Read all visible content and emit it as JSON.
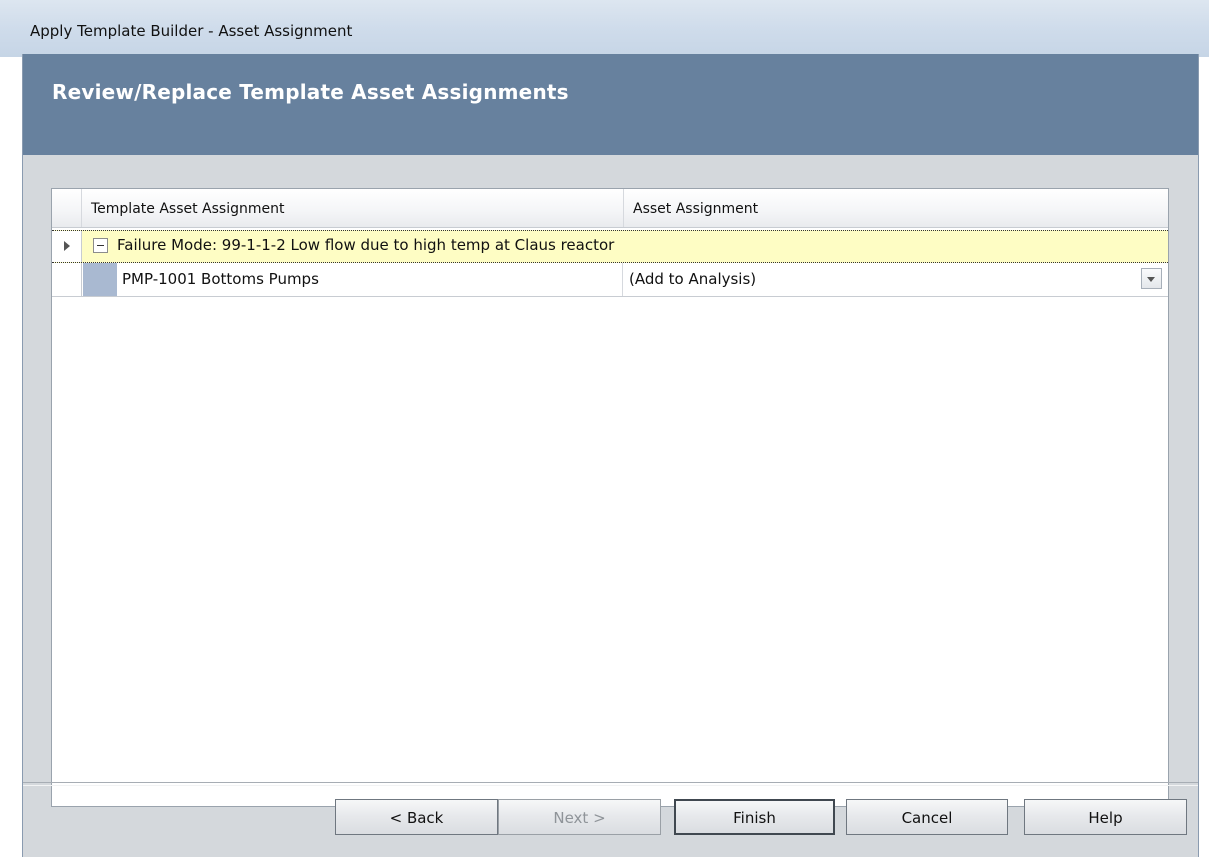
{
  "window": {
    "title": "Apply Template Builder - Asset Assignment"
  },
  "header": {
    "title": "Review/Replace Template Asset Assignments"
  },
  "grid": {
    "columns": [
      "Template Asset Assignment",
      "Asset Assignment"
    ],
    "group": {
      "label": "Failure Mode: 99-1-1-2 Low flow due to high temp at Claus reactor"
    },
    "rows": [
      {
        "template_asset": "PMP-1001 Bottoms Pumps",
        "asset_assignment": "(Add to Analysis)"
      }
    ]
  },
  "buttons": {
    "back": "< Back",
    "next": "Next >",
    "finish": "Finish",
    "cancel": "Cancel",
    "help": "Help"
  },
  "colors": {
    "header_band": "#67819e",
    "group_row_bg": "#fefdc4",
    "indent_block": "#a9b9d1",
    "frame_bg": "#d4d8dc"
  }
}
